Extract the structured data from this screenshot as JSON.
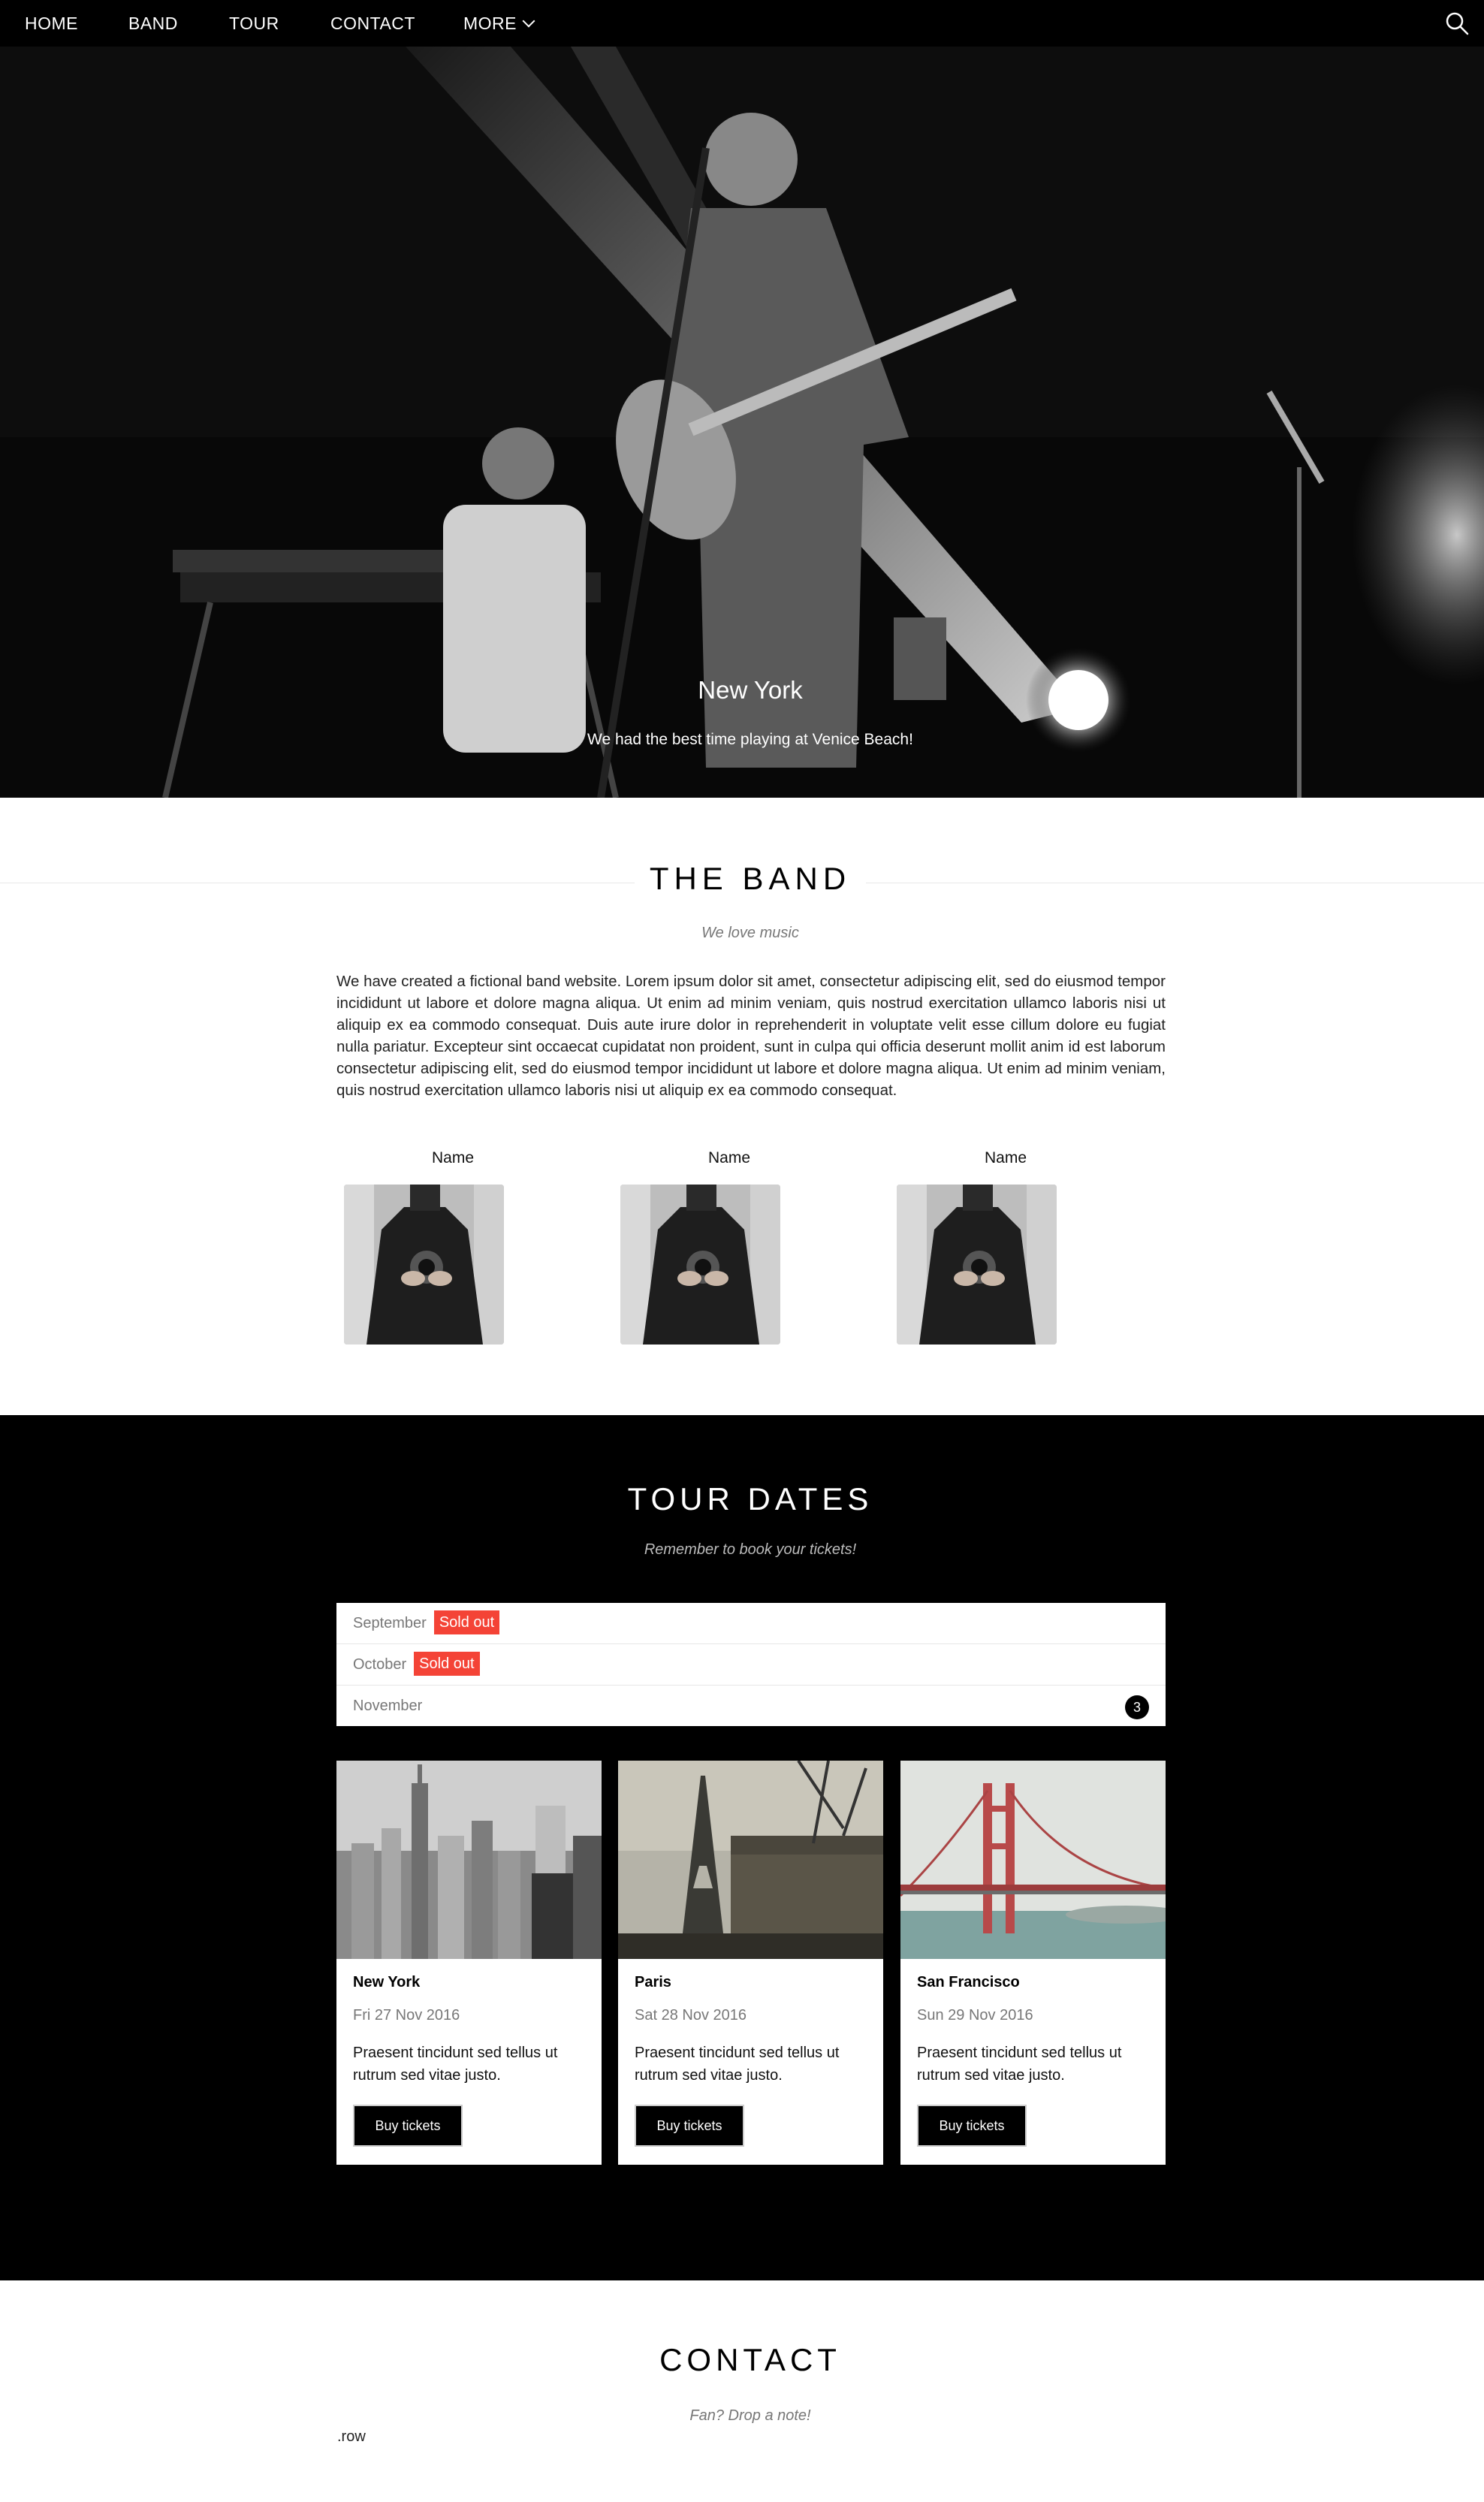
{
  "nav": {
    "items": [
      "HOME",
      "BAND",
      "TOUR",
      "CONTACT"
    ],
    "more_label": "MORE",
    "search_icon": "search-icon"
  },
  "hero": {
    "title": "New York",
    "subtitle": "We had the best time playing at Venice Beach!"
  },
  "band": {
    "title": "THE BAND",
    "subtitle": "We love music",
    "text": "We have created a fictional band website. Lorem ipsum dolor sit amet, consectetur adipiscing elit, sed do eiusmod tempor incididunt ut labore et dolore magna aliqua. Ut enim ad minim veniam, quis nostrud exercitation ullamco laboris nisi ut aliquip ex ea commodo consequat. Duis aute irure dolor in reprehenderit in voluptate velit esse cillum dolore eu fugiat nulla pariatur. Excepteur sint occaecat cupidatat non proident, sunt in culpa qui officia deserunt mollit anim id est laborum consectetur adipiscing elit, sed do eiusmod tempor incididunt ut labore et dolore magna aliqua. Ut enim ad minim veniam, quis nostrud exercitation ullamco laboris nisi ut aliquip ex ea commodo consequat.",
    "members": [
      {
        "name": "Name"
      },
      {
        "name": "Name"
      },
      {
        "name": "Name"
      }
    ]
  },
  "tour": {
    "title": "TOUR DATES",
    "subtitle": "Remember to book your tickets!",
    "months": [
      {
        "month": "September",
        "badge": "Sold out"
      },
      {
        "month": "October",
        "badge": "Sold out"
      },
      {
        "month": "November",
        "count": "3"
      }
    ],
    "cards": [
      {
        "city": "New York",
        "date": "Fri 27 Nov 2016",
        "text": "Praesent tincidunt sed tellus ut rutrum sed vitae justo.",
        "button": "Buy tickets"
      },
      {
        "city": "Paris",
        "date": "Sat 28 Nov 2016",
        "text": "Praesent tincidunt sed tellus ut rutrum sed vitae justo.",
        "button": "Buy tickets"
      },
      {
        "city": "San Francisco",
        "date": "Sun 29 Nov 2016",
        "text": "Praesent tincidunt sed tellus ut rutrum sed vitae justo.",
        "button": "Buy tickets"
      }
    ]
  },
  "contact": {
    "title": "CONTACT",
    "subtitle": "Fan? Drop a note!",
    "row_text": ".row"
  },
  "colors": {
    "nav_bg": "#000000",
    "badge_red": "#f44336",
    "tour_bg": "#000000"
  }
}
